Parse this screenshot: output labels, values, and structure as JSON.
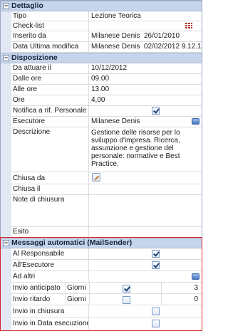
{
  "sections": {
    "dettaglio": {
      "title": "Dettaglio",
      "toggle": "−"
    },
    "disposizione": {
      "title": "Disposizione",
      "toggle": "−"
    },
    "messaggi": {
      "title": "Messaggi automatici (MailSender)",
      "toggle": "−"
    }
  },
  "dettaglio": {
    "tipo": {
      "label": "Tipo",
      "value": "Lezione Teorica"
    },
    "checklist": {
      "label": "Check-list"
    },
    "inserito": {
      "label": "Inserito da",
      "user": "Milanese Denis",
      "date": "26/01/2010"
    },
    "ultima": {
      "label": "Data Ultima modifica",
      "user": "Milanese Denis",
      "date": "02/02/2012 9.12.16"
    }
  },
  "disposizione": {
    "da_attuare": {
      "label": "Da attuare il",
      "value": "10/12/2012"
    },
    "dalle": {
      "label": "Dalle ore",
      "value": "09.00"
    },
    "alle": {
      "label": "Alle ore",
      "value": "13.00"
    },
    "ore": {
      "label": "Ore",
      "value": "4,00"
    },
    "notifica": {
      "label": "Notifica a rif. Personale",
      "checked": true
    },
    "esecutore": {
      "label": "Esecutore",
      "value": "Milanese Denis"
    },
    "descrizione": {
      "label": "Descrizione",
      "value": "Gestione delle risorse per lo sviluppo d'impresa.\nRicerca, assunzione e gestione del personale: normative e Best Practice."
    },
    "chiusa_da": {
      "label": "Chiusa da"
    },
    "chiusa_il": {
      "label": "Chiusa il",
      "value": ""
    },
    "note": {
      "label": "Note di chiusura",
      "value": ""
    },
    "esito": {
      "label": "Esito",
      "value": ""
    }
  },
  "messaggi": {
    "responsabile": {
      "label": "Al Responsabile",
      "checked": true
    },
    "esecutore": {
      "label": "All'Esecutore",
      "checked": true
    },
    "altri": {
      "label": "Ad altri"
    },
    "anticipato": {
      "label": "Invio anticipato",
      "unit": "Giorni",
      "checked": true,
      "value": "3"
    },
    "ritardo": {
      "label": "Invio ritardo",
      "unit": "Giorni",
      "checked": false,
      "value": "0"
    },
    "chiusura": {
      "label": "Invio in chiusura",
      "checked": false
    },
    "data_esecuzione": {
      "label": "Invio in Data esecuzione",
      "checked": false
    }
  },
  "icons": {
    "checklist": "checklist-grid-icon",
    "esecutore_btn": "ellipsis-button",
    "altri_btn": "ellipsis-button",
    "chiusa_da": "pencil-icon"
  },
  "colors": {
    "header_bg": "#c7d5ea",
    "highlight_border": "#d9232e"
  }
}
